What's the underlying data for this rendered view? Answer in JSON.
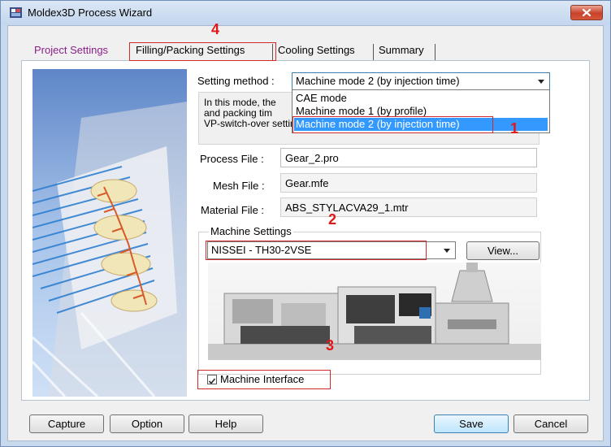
{
  "window": {
    "title": "Moldex3D Process Wizard"
  },
  "tabs": [
    {
      "label": "Project Settings",
      "color": "#8a1f8a"
    },
    {
      "label": "Filling/Packing Settings"
    },
    {
      "label": "Cooling Settings"
    },
    {
      "label": "Summary"
    }
  ],
  "setting_method": {
    "label": "Setting method :",
    "selected": "Machine mode 2 (by injection time)",
    "options": [
      "CAE mode",
      "Machine mode 1 (by profile)",
      "Machine mode 2 (by injection time)"
    ],
    "description_lines": [
      "In this mode, the",
      "and packing tim",
      "VP-switch-over settings."
    ]
  },
  "files": {
    "process_label": "Process File :",
    "process_value": "Gear_2.pro",
    "mesh_label": "Mesh File :",
    "mesh_value": "Gear.mfe",
    "material_label": "Material File :",
    "material_value": "ABS_STYLACVA29_1.mtr"
  },
  "machine": {
    "group_label": "Machine Settings",
    "selected": "NISSEI - TH30-2VSE",
    "view_label": "View...",
    "interface_label": "Machine Interface",
    "interface_checked": true
  },
  "buttons": {
    "capture": "Capture",
    "option": "Option",
    "help": "Help",
    "save": "Save",
    "cancel": "Cancel"
  },
  "annotations": [
    "1",
    "2",
    "3",
    "4"
  ],
  "colors": {
    "annotation": "#d12a2a",
    "selection": "#3399ff"
  }
}
